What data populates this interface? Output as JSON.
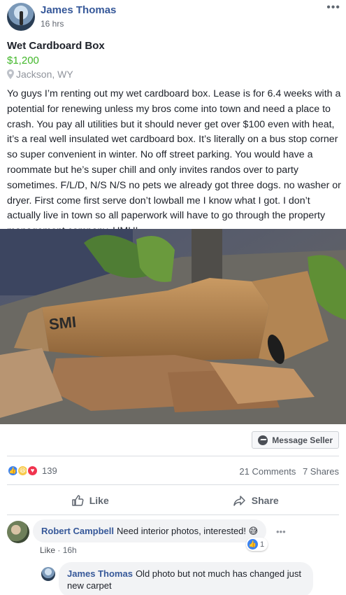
{
  "post": {
    "author": "James Thomas",
    "time": "16 hrs",
    "more": "•••"
  },
  "listing": {
    "title": "Wet Cardboard Box",
    "price": "$1,200",
    "location": "Jackson, WY",
    "description": "Yo guys I’m renting out my wet cardboard box. Lease is for 6.4 weeks with a potential for renewing unless my bros come into town and need a place to crash. You pay all utilities but it should never get over $100 even with heat, it’s a real well insulated wet cardboard box. It’s literally on a bus stop corner so super convenient in winter. No off street parking. You would have a roommate but he’s super chill and only invites randos over to party sometimes. F/L/D, N/S N/S no pets we already got three dogs. no washer or dryer. First come first serve don’t lowball me I know what I got. I don’t actually live in town so all paperwork will have to go through the property management company. HMU!",
    "photo_label": "SMI"
  },
  "message_seller": "Message Seller",
  "engagement": {
    "reaction_count": "139",
    "comments": "21 Comments",
    "shares": "7 Shares"
  },
  "actions": {
    "like": "Like",
    "share": "Share"
  },
  "comments": [
    {
      "author": "Robert Campbell",
      "text": "Need interior photos, interested! 😅",
      "like_label": "Like",
      "separator": " · ",
      "time": "16h",
      "reaction_count": "1",
      "more": "•••"
    },
    {
      "author": "James Thomas",
      "text": "Old photo but not much has changed just new carpet"
    }
  ],
  "colors": {
    "name_blue": "#365899",
    "price_green": "#42b72a",
    "muted": "#606770"
  }
}
